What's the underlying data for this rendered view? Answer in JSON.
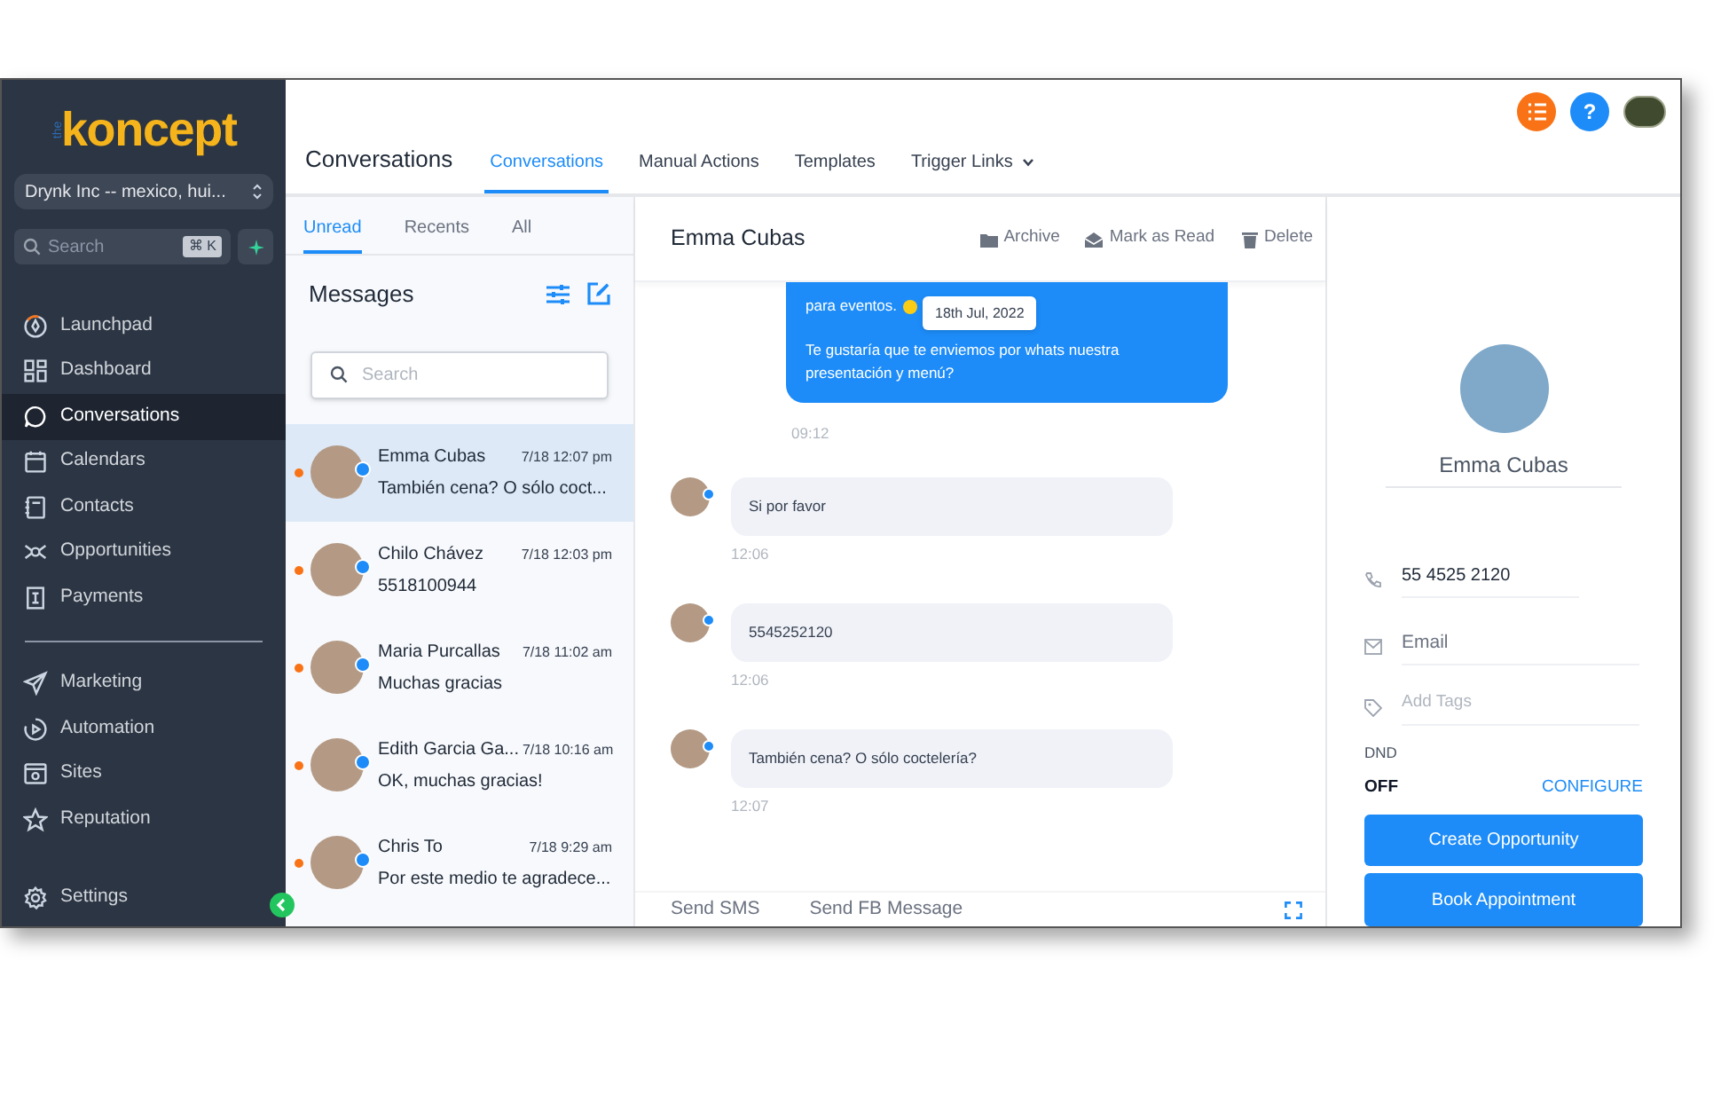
{
  "logo": {
    "prefix": "the",
    "text": "koncept"
  },
  "sidebar": {
    "account": "Drynk Inc -- mexico, hui...",
    "search": {
      "placeholder": "Search",
      "shortcut": "⌘ K"
    },
    "groups": [
      [
        {
          "label": "Launchpad",
          "selected": false
        },
        {
          "label": "Dashboard",
          "selected": false
        },
        {
          "label": "Conversations",
          "selected": true
        },
        {
          "label": "Calendars",
          "selected": false
        },
        {
          "label": "Contacts",
          "selected": false
        },
        {
          "label": "Opportunities",
          "selected": false
        },
        {
          "label": "Payments",
          "selected": false
        }
      ],
      [
        {
          "label": "Marketing",
          "selected": false
        },
        {
          "label": "Automation",
          "selected": false
        },
        {
          "label": "Sites",
          "selected": false
        },
        {
          "label": "Reputation",
          "selected": false
        }
      ]
    ],
    "settings": "Settings"
  },
  "header": {
    "title": "Conversations",
    "tabs": [
      {
        "label": "Conversations",
        "selected": true,
        "dropdown": false
      },
      {
        "label": "Manual Actions",
        "selected": false,
        "dropdown": false
      },
      {
        "label": "Templates",
        "selected": false,
        "dropdown": false
      },
      {
        "label": "Trigger Links",
        "selected": false,
        "dropdown": true
      }
    ],
    "help": "?"
  },
  "list": {
    "tabs": [
      {
        "label": "Unread",
        "selected": true
      },
      {
        "label": "Recents",
        "selected": false
      },
      {
        "label": "All",
        "selected": false
      }
    ],
    "title": "Messages",
    "search": {
      "placeholder": "Search"
    },
    "conversations": [
      {
        "name": "Emma Cubas",
        "time": "7/18 12:07 pm",
        "preview": "También cena? O sólo coct...",
        "unread": true,
        "selected": true
      },
      {
        "name": "Chilo Chávez",
        "time": "7/18 12:03 pm",
        "preview": "5518100944",
        "unread": true,
        "selected": false
      },
      {
        "name": "Maria Purcallas",
        "time": "7/18 11:02 am",
        "preview": "Muchas gracias",
        "unread": true,
        "selected": false
      },
      {
        "name": "Edith Garcia Ga...",
        "time": "7/18 10:16 am",
        "preview": "OK, muchas gracias!",
        "unread": true,
        "selected": false
      },
      {
        "name": "Chris To",
        "time": "7/18 9:29 am",
        "preview": "Por este medio te agradece...",
        "unread": true,
        "selected": false
      }
    ]
  },
  "chat": {
    "contact": "Emma Cubas",
    "actions": [
      "Archive",
      "Mark as Read",
      "Delete"
    ],
    "date_chip": "18th Jul, 2022",
    "messages": [
      {
        "kind": "outgoing",
        "lines": [
          "para eventos.",
          "Te gustaría que te enviemos por whats nuestra presentación y menú?"
        ],
        "time": "09:12"
      },
      {
        "kind": "incoming",
        "lines": [
          "Si por favor"
        ],
        "time": "12:06"
      },
      {
        "kind": "incoming",
        "lines": [
          "5545252120"
        ],
        "time": "12:06"
      },
      {
        "kind": "incoming",
        "lines": [
          "También cena? O sólo coctelería?"
        ],
        "time": "12:07"
      }
    ],
    "composer_tabs": [
      "Send SMS",
      "Send FB Message"
    ]
  },
  "contact": {
    "name": "Emma Cubas",
    "phone": "55 4525 2120",
    "email": {
      "placeholder": "Email"
    },
    "tags": {
      "placeholder": "Add Tags"
    },
    "dnd_label": "DND",
    "dnd_value": "OFF",
    "configure": "CONFIGURE",
    "buttons": [
      "Create Opportunity",
      "Book Appointment"
    ]
  }
}
